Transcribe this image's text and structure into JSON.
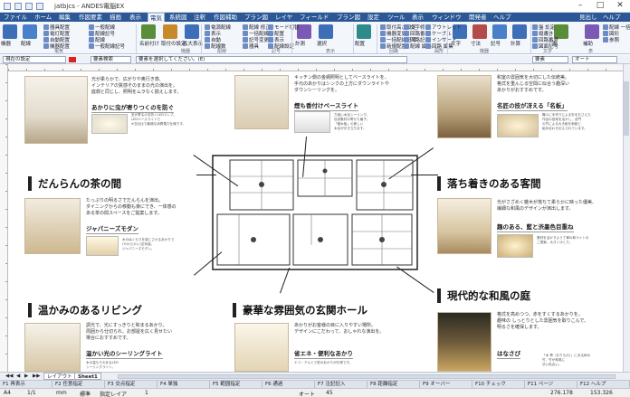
{
  "window": {
    "title": "jatbjcs - ANDES電脳EX",
    "controls": {
      "min": "–",
      "max": "□",
      "close": "✕"
    }
  },
  "menu": {
    "tabs": [
      "ファイル",
      "ホーム",
      "編集",
      "作図要素",
      "描画",
      "表示",
      "電気",
      "系統図",
      "注釈",
      "作図補助",
      "プラン図",
      "レイヤ",
      "フィールド",
      "プラン図",
      "設定",
      "ツール",
      "表示",
      "ウィンドウ",
      "開発者",
      "ヘルプ"
    ],
    "active_index": 6,
    "right_items": [
      "見出し",
      "ヘルプ"
    ]
  },
  "ribbon": {
    "big_buttons": [
      "機器",
      "配線",
      "名前付け",
      "取付の設定",
      "拡大表示",
      "計測",
      "選択",
      "配置",
      "文字",
      "寸法",
      "記号",
      "計算",
      "表",
      "補助"
    ],
    "small_buttons": [
      "器具配置",
      "電灯配置",
      "自動配置",
      "機器配置",
      "一般配線",
      "配線記号",
      "配線",
      "一般配線記号",
      "電源配線",
      "表示",
      "自動",
      "配線数",
      "配線 修正",
      "一括配線",
      "記号変更",
      "器具",
      "モード切替",
      "配置",
      "表示",
      "配線設定",
      "取付高さ設定",
      "機器変更",
      "一括配線記号",
      "新規配置",
      "文字修正",
      "回路番号",
      "回路記号",
      "配線 編集",
      "アウトレット",
      "ケーブル",
      "インサート",
      "回路 編集",
      "盤 設定",
      "縦書き",
      "回路番号",
      "図面記号",
      "配線 一括",
      "図形",
      "参照"
    ],
    "groups": [
      "電気",
      "機器",
      "配線",
      "記号",
      "表示",
      "回路",
      "図形",
      "機器",
      "文字",
      "表"
    ]
  },
  "toolbar": {
    "layer_label": "現在の設定",
    "mode_label": "要素検索",
    "status_text": "要素を選択してください。(E)",
    "right_select": "要素",
    "right_mode": "オート"
  },
  "document": {
    "headings": [
      "だんらんの茶の間",
      "落ち着きのある客間",
      "温かみのあるリビング",
      "豪華な雰囲気の玄関ホール",
      "現代的な和風の庭"
    ],
    "subheadings": [
      "あかりに虫が寄りつくのを防ぐ",
      "煙も香付けベースライト",
      "名匠の技が冴える「名板」",
      "ジャパニーズモダン",
      "趣のある、藍と渋墨色目重ね",
      "温かい光のシーリングライト",
      "省エネ・便利なあかり",
      "はなさび"
    ],
    "texts": {
      "t1": "光が柔らかで、広がりや奥行き感、\nインテリアの質感そのままの光の演出を。\n庭側と同じし、照明をムラなく揃えします。",
      "t2": "キッチン側の金網照明としてベースライトを、\n手元のあかりはシンクの上方にダウンライトや\nダウンシーリングを。",
      "t3": "和室の雰囲気を大切にした伝統美。\n格式を重んじる空間に似合う趣深い\nあかりがおすすめです。",
      "t4": "たっぷりの明るさでだんらんを演出。\nダイニングからの移動も楽にでき、一体感の\nある茶の間スペースをご提案します。",
      "t5": "光がさざめく雑木が落ちて柔らかに映った優美、\n繊細な和風のデザインが演出します。",
      "t6": "調光で、光にすっきりと和まるあかり。\n周囲から仕切られ、お部屋を広く見せたい\n場合におすすめです。",
      "t7": "あかりがお客様の目に入りやすい場所。\nデザインにこだわって、おしゃれな演出を。",
      "t8": "格式を高めつつ、赤をすくするあかりを。\n趣味の しっとりとした雰囲気を取りこんで、\n明るさを確保します。"
    },
    "captions": {
      "c1": "虫が寄るのを防ぐLEDランプ。\nLEDベースライトで\n※当社比で最適な消費電力仕様です。",
      "c2": "力強い木目シーリング。\n自然素材の寄せた格子。\n「樹木板」の美しい\n木目が引き立ちます。",
      "c3": "職人に手作りによる杉をおさえた\n作品の技術を活かし、名門\nの竹による大き紙を和紙と\n組み合わせ伝えられています。",
      "c4": "木のぬくもりを感じさせるあかりで\n(やわらかい)空気感。\nジャパニーズモダン。",
      "c5": "素材を活かすよう丁寧の和ライトの\nご提案、大きくゆとり。",
      "c6": "木の温もりのあるLED\nシーリングライト。",
      "c7": "エコ・アルミで窓のあかりがお得です。",
      "c8": "「木 寄（おりもの）」にある和の\n竹、竹が和風に\n渋い色合い。"
    }
  },
  "sheets": {
    "nav": [
      "◀◀",
      "◀",
      "▶",
      "▶▶"
    ],
    "tabs": [
      "レイアウト",
      "Sheet1"
    ],
    "active": "Sheet1"
  },
  "fkeys": [
    "F1 再表示",
    "F2 任意指定",
    "F3 交点指定",
    "F4 単独",
    "F5 範囲指定",
    "F6 通過",
    "F7 注記記入",
    "F8 距離指定",
    "F9 オーバー",
    "F10 チェック",
    "F11 ページ",
    "F12 ヘルプ"
  ],
  "status": {
    "paper": "A4",
    "page": "1/1",
    "unit": "mm",
    "mode": "標準",
    "scale_label": "指定レイア",
    "value1": "1",
    "snap": "オート",
    "zoom": "45",
    "coord_x": "276.178",
    "coord_y": "153.326"
  },
  "colors": {
    "menu_bg": "#2b5797",
    "ribbon_bg": "#f3f6fb",
    "accent": "#2b5797"
  }
}
